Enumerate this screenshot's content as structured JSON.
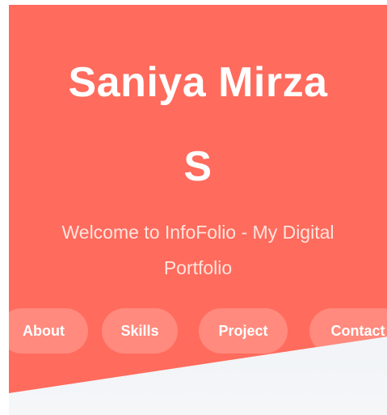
{
  "hero": {
    "name_line1": "Saniya Mirza",
    "name_line2": "S",
    "tagline_line1": "Welcome to InfoFolio - My Digital",
    "tagline_line2": "Portfolio"
  },
  "nav": {
    "items": [
      {
        "label": "About"
      },
      {
        "label": "Skills"
      },
      {
        "label": "Project"
      },
      {
        "label": "Contact"
      }
    ]
  },
  "colors": {
    "hero_background": "#ff6b5d",
    "button_background": "#ff8a7d",
    "text": "#ffffff",
    "lower_background": "#e7ecf1"
  }
}
